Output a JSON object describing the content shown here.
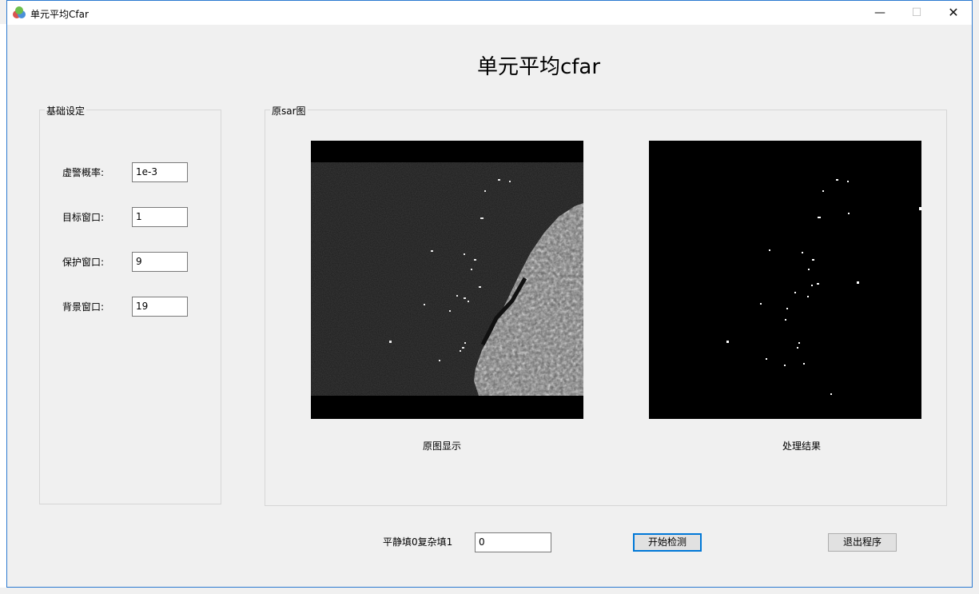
{
  "window": {
    "title": "单元平均Cfar"
  },
  "header": {
    "title": "单元平均cfar"
  },
  "settings": {
    "legend": "基础设定",
    "fields": [
      {
        "label": "虚警概率:",
        "value": "1e-3"
      },
      {
        "label": "目标窗口:",
        "value": "1"
      },
      {
        "label": "保护窗口:",
        "value": "9"
      },
      {
        "label": "背景窗口:",
        "value": "19"
      }
    ]
  },
  "image_panel": {
    "legend": "原sar图",
    "original_caption": "原图显示",
    "result_caption": "处理结果"
  },
  "footer": {
    "mode_label": "平静填0复杂填1",
    "mode_value": "0",
    "start_label": "开始检测",
    "exit_label": "退出程序"
  },
  "colors": {
    "accent": "#0078d7",
    "window_border": "#2b79d0"
  }
}
